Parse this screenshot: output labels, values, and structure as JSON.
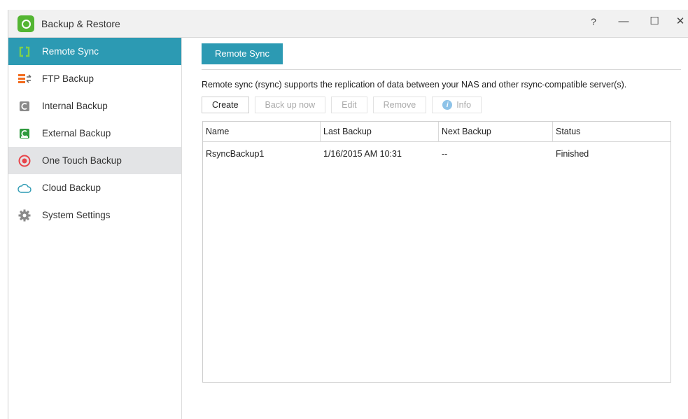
{
  "window": {
    "title": "Backup & Restore",
    "controls": {
      "help": "?",
      "minimize": "—",
      "maximize": "☐",
      "close": "✕"
    }
  },
  "sidebar": {
    "items": [
      {
        "label": "Remote Sync",
        "icon": "remote-sync-icon",
        "state": "active"
      },
      {
        "label": "FTP Backup",
        "icon": "ftp-backup-icon",
        "state": "normal"
      },
      {
        "label": "Internal Backup",
        "icon": "internal-backup-icon",
        "state": "normal"
      },
      {
        "label": "External Backup",
        "icon": "external-backup-icon",
        "state": "normal"
      },
      {
        "label": "One Touch Backup",
        "icon": "one-touch-backup-icon",
        "state": "hover"
      },
      {
        "label": "Cloud Backup",
        "icon": "cloud-icon",
        "state": "normal"
      },
      {
        "label": "System Settings",
        "icon": "gear-icon",
        "state": "normal"
      }
    ]
  },
  "main": {
    "tab": "Remote Sync",
    "description": "Remote sync (rsync) supports the replication of data between your NAS and other rsync-compatible server(s).",
    "toolbar": {
      "create": "Create",
      "backup_now": "Back up now",
      "edit": "Edit",
      "remove": "Remove",
      "info": "Info"
    },
    "table": {
      "columns": [
        "Name",
        "Last Backup",
        "Next Backup",
        "Status"
      ],
      "rows": [
        [
          "RsyncBackup1",
          "1/16/2015 AM 10:31",
          "--",
          "Finished"
        ]
      ]
    }
  },
  "colors": {
    "accent": "#2c9ab3",
    "app_icon": "#53b532",
    "hover_row": "#e3e4e6"
  }
}
